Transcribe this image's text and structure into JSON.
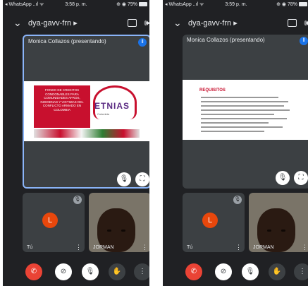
{
  "screens": [
    {
      "status": {
        "carrier": "◂ WhatsApp ..ıl ᯤ",
        "time": "3:58 p. m.",
        "battery": "⊕ ◉ 79%"
      },
      "meeting_code": "dya-gavv-frn ▸",
      "presenter_label": "Monica Collazos (presentando)",
      "slide": {
        "red_text": "FONDO DE CREDITOS CONDONABLES PARA COMUNIDADES AFROS, INDIGENAS Y VICTIMAS DEL CONFLICTO ARMADO EN COLOMBIA",
        "logo_text": "ETNIAS",
        "logo_sub": "Colombia"
      },
      "self_tile": {
        "avatar_letter": "L",
        "name": "Tú"
      },
      "remote_tile": {
        "name": "JORMAN"
      }
    },
    {
      "status": {
        "carrier": "◂ WhatsApp ..ıl ᯤ",
        "time": "3:59 p. m.",
        "battery": "⊕ ◉ 78%"
      },
      "meeting_code": "dya-gavv-frn ▸",
      "presenter_label": "Monica Collazos (presentando)",
      "slide": {
        "title": "REQUISITOS"
      },
      "self_tile": {
        "avatar_letter": "L",
        "name": "Tú"
      },
      "remote_tile": {
        "name": "JORMAN"
      }
    }
  ],
  "icons": {
    "back": "chevron-down-icon",
    "camera_flip": "camera-flip-icon",
    "speaker": "speaker-icon",
    "end_call": "end-call-icon",
    "camera_off": "camera-off-icon",
    "mic_off": "mic-off-icon",
    "raise_hand": "raise-hand-icon",
    "more": "more-vert-icon"
  },
  "colors": {
    "background": "#202124",
    "accent": "#1a73e8",
    "end_call": "#ea4335",
    "avatar": "#e8470c"
  }
}
